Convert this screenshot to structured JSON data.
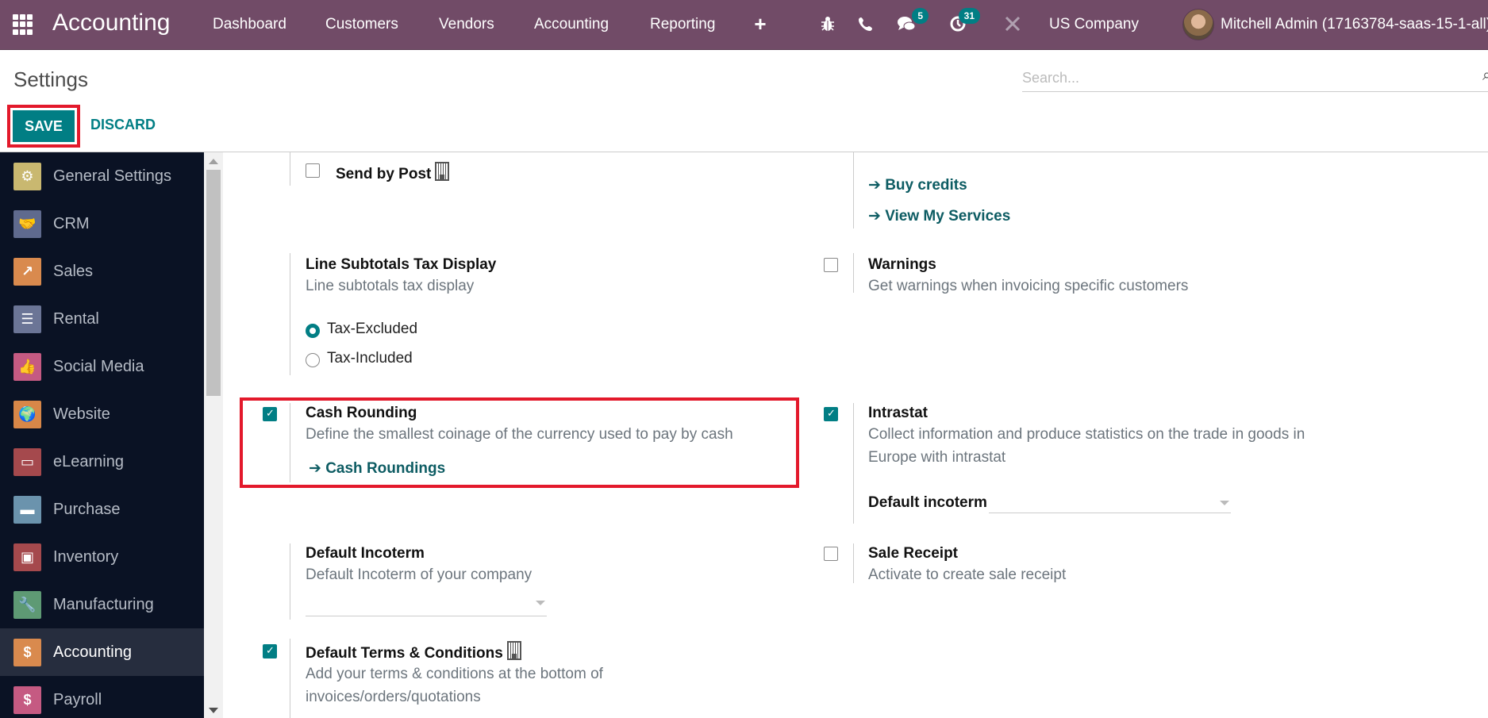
{
  "navbar": {
    "app_name": "Accounting",
    "menu": [
      "Dashboard",
      "Customers",
      "Vendors",
      "Accounting",
      "Reporting"
    ],
    "icons": [
      "plus-icon",
      "bug-icon",
      "phone-icon",
      "chat-icon",
      "activity-clock-icon",
      "tools-icon"
    ],
    "messages_badge": "5",
    "activities_badge": "31",
    "company": "US Company",
    "user": "Mitchell Admin (17163784-saas-15-1-all)"
  },
  "control_panel": {
    "title": "Settings",
    "search_placeholder": "Search...",
    "save_label": "SAVE",
    "discard_label": "DISCARD"
  },
  "sidebar": {
    "items": [
      {
        "label": "General Settings",
        "icon": "gear-icon",
        "color": "#c9b870"
      },
      {
        "label": "CRM",
        "icon": "handshake-icon",
        "color": "#5f6a8e"
      },
      {
        "label": "Sales",
        "icon": "chart-up-icon",
        "color": "#d98a4e"
      },
      {
        "label": "Rental",
        "icon": "rental-icon",
        "color": "#6b7596"
      },
      {
        "label": "Social Media",
        "icon": "thumbs-up-icon",
        "color": "#c55a82"
      },
      {
        "label": "Website",
        "icon": "globe-icon",
        "color": "#d88748"
      },
      {
        "label": "eLearning",
        "icon": "presentation-icon",
        "color": "#a5494d"
      },
      {
        "label": "Purchase",
        "icon": "credit-card-icon",
        "color": "#6b93ad"
      },
      {
        "label": "Inventory",
        "icon": "box-icon",
        "color": "#a5494d"
      },
      {
        "label": "Manufacturing",
        "icon": "wrench-icon",
        "color": "#5e9a74"
      },
      {
        "label": "Accounting",
        "icon": "invoice-dollar-icon",
        "color": "#d98a4e",
        "active": true
      },
      {
        "label": "Payroll",
        "icon": "payroll-icon",
        "color": "#c55a82"
      }
    ]
  },
  "settings": {
    "send_by_post": {
      "label": "Send by Post",
      "checked": false
    },
    "buy_credits": "Buy credits",
    "view_my_services": "View My Services",
    "line_subtotals": {
      "title": "Line Subtotals Tax Display",
      "desc": "Line subtotals tax display",
      "options": [
        {
          "label": "Tax-Excluded",
          "selected": true
        },
        {
          "label": "Tax-Included",
          "selected": false
        }
      ]
    },
    "warnings": {
      "title": "Warnings",
      "desc": "Get warnings when invoicing specific customers",
      "checked": false
    },
    "cash_rounding": {
      "title": "Cash Rounding",
      "desc": "Define the smallest coinage of the currency used to pay by cash",
      "link": "Cash Roundings",
      "checked": true
    },
    "intrastat": {
      "title": "Intrastat",
      "desc_line1": "Collect information and produce statistics on the trade in goods in",
      "desc_line2": "Europe with intrastat",
      "checked": true,
      "field_label": "Default incoterm",
      "field_value": ""
    },
    "default_incoterm": {
      "title": "Default Incoterm",
      "desc": "Default Incoterm of your company",
      "value": ""
    },
    "sale_receipt": {
      "title": "Sale Receipt",
      "desc": "Activate to create sale receipt",
      "checked": false
    },
    "default_terms": {
      "title": "Default Terms & Conditions",
      "desc_line1": "Add your terms & conditions at the bottom of",
      "desc_line2": "invoices/orders/quotations",
      "checked": true
    }
  },
  "colors": {
    "navbar": "#714b67",
    "primary": "#017e84",
    "highlight": "#e3192b",
    "sidebar": "#0a1224"
  }
}
